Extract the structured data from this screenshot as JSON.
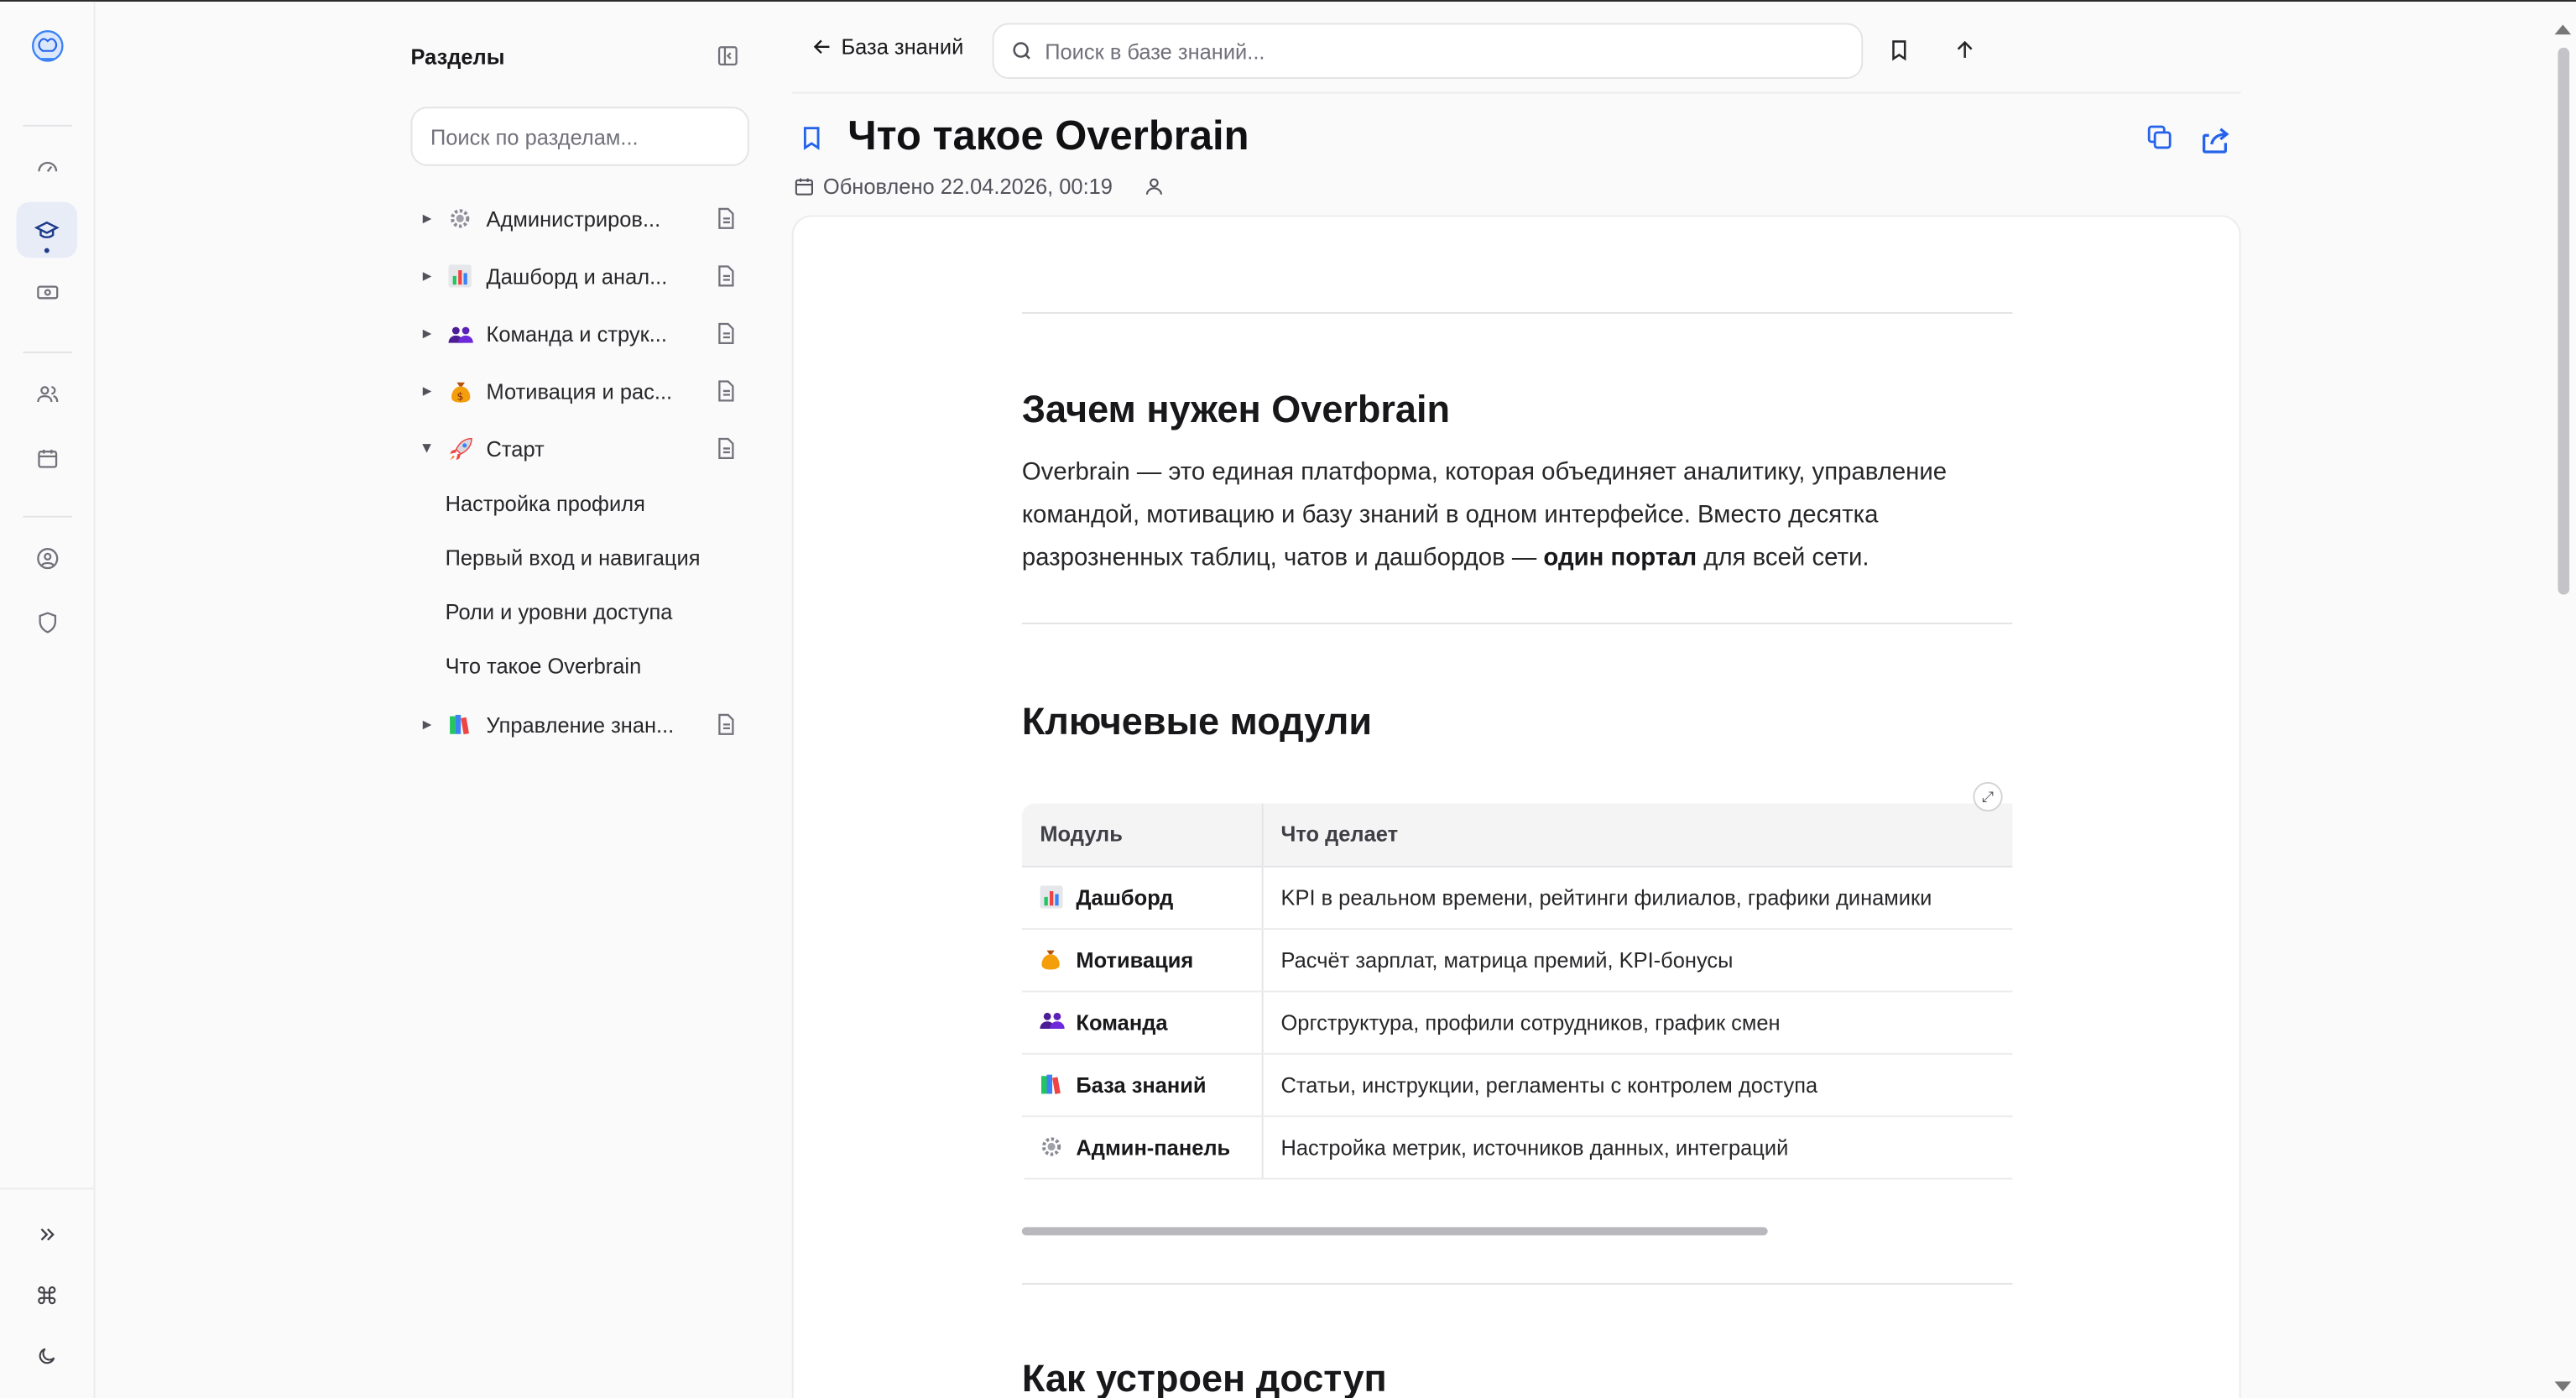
{
  "rail": {
    "logo_icon": "brain-logo-icon",
    "items": [
      {
        "name": "dashboard",
        "icon": "gauge-icon"
      },
      {
        "name": "knowledge",
        "icon": "graduation-cap-icon",
        "active": true
      },
      {
        "name": "motivation",
        "icon": "banknote-icon"
      },
      {
        "name": "team",
        "icon": "users-icon"
      },
      {
        "name": "calendar",
        "icon": "calendar-icon"
      },
      {
        "name": "profile",
        "icon": "user-circle-icon"
      },
      {
        "name": "admin",
        "icon": "shield-icon"
      }
    ],
    "bottom": [
      "chevrons-right-icon",
      "command-icon",
      "moon-icon"
    ]
  },
  "sections": {
    "title": "Разделы",
    "search_placeholder": "Поиск по разделам...",
    "items": [
      {
        "label": "Администриров...",
        "emoji": "gear-icon"
      },
      {
        "label": "Дашборд и анал...",
        "emoji": "bar-chart-icon"
      },
      {
        "label": "Команда и струк...",
        "emoji": "people-icon"
      },
      {
        "label": "Мотивация и рас...",
        "emoji": "money-bag-icon"
      },
      {
        "label": "Старт",
        "emoji": "rocket-icon",
        "open": true
      },
      {
        "label": "Управление знан...",
        "emoji": "books-icon"
      }
    ],
    "start_children": [
      "Настройка профиля",
      "Первый вход и навигация",
      "Роли и уровни доступа",
      "Что такое Overbrain"
    ]
  },
  "topbar": {
    "back_label": "База знаний",
    "search_placeholder": "Поиск в базе знаний..."
  },
  "page": {
    "title": "Что такое Overbrain",
    "updated": "Обновлено 22.04.2026, 00:19"
  },
  "article": {
    "h2_why": "Зачем нужен Overbrain",
    "para_1": "Overbrain — это единая платформа, которая объединяет аналитику, управление командой, мотивацию и базу знаний в одном интерфейсе. Вместо десятка разрозненных таблиц, чатов и дашбордов — ",
    "para_bold": "один портал",
    "para_2": " для всей сети.",
    "h2_modules": "Ключевые модули",
    "table": {
      "headers": [
        "Модуль",
        "Что делает"
      ],
      "rows": [
        {
          "emoji": "bar-chart-icon",
          "module": "Дашборд",
          "desc": "KPI в реальном времени, рейтинги филиалов, графики динамики"
        },
        {
          "emoji": "money-bag-icon",
          "module": "Мотивация",
          "desc": "Расчёт зарплат, матрица премий, KPI-бонусы"
        },
        {
          "emoji": "people-icon",
          "module": "Команда",
          "desc": "Оргструктура, профили сотрудников, график смен"
        },
        {
          "emoji": "books-icon",
          "module": "База знаний",
          "desc": "Статьи, инструкции, регламенты с контролем доступа"
        },
        {
          "emoji": "gear-icon",
          "module": "Админ-панель",
          "desc": "Настройка метрик, источников данных, интеграций"
        }
      ]
    },
    "h2_access": "Как устроен доступ"
  },
  "colors": {
    "accent": "#2563eb",
    "active_bg": "#e8ecf7",
    "active_fg": "#1e3a8a"
  }
}
